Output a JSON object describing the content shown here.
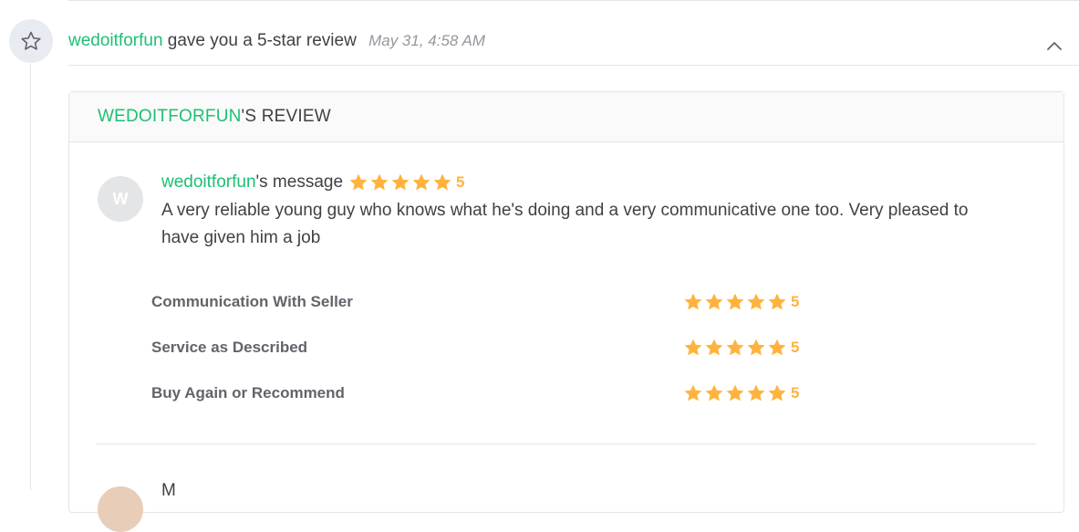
{
  "event": {
    "username": "wedoitforfun",
    "action": "gave you a 5-star review",
    "time": "May 31, 4:58 AM",
    "icon": "star-outline-icon",
    "collapse_icon": "chevron-up-icon"
  },
  "review": {
    "title_user": "WEDOITFORFUN",
    "title_suffix": "'S REVIEW",
    "avatar_letter": "W",
    "message_user": "wedoitforfun",
    "message_suffix": "'s message",
    "overall_rating": 5,
    "overall_rating_text": "5",
    "message_text": "A very reliable young guy who knows what he's doing and a very communicative one too. Very pleased to have given him a job",
    "criteria": [
      {
        "label": "Communication With Seller",
        "rating": 5,
        "rating_text": "5"
      },
      {
        "label": "Service as Described",
        "rating": 5,
        "rating_text": "5"
      },
      {
        "label": "Buy Again or Recommend",
        "rating": 5,
        "rating_text": "5"
      }
    ]
  },
  "next_message": {
    "name_initial": "M"
  },
  "colors": {
    "brand_green": "#1dbf73",
    "star_orange": "#ffb33e",
    "text_dark": "#404145",
    "text_muted": "#95979d",
    "border": "#e4e5e7"
  }
}
